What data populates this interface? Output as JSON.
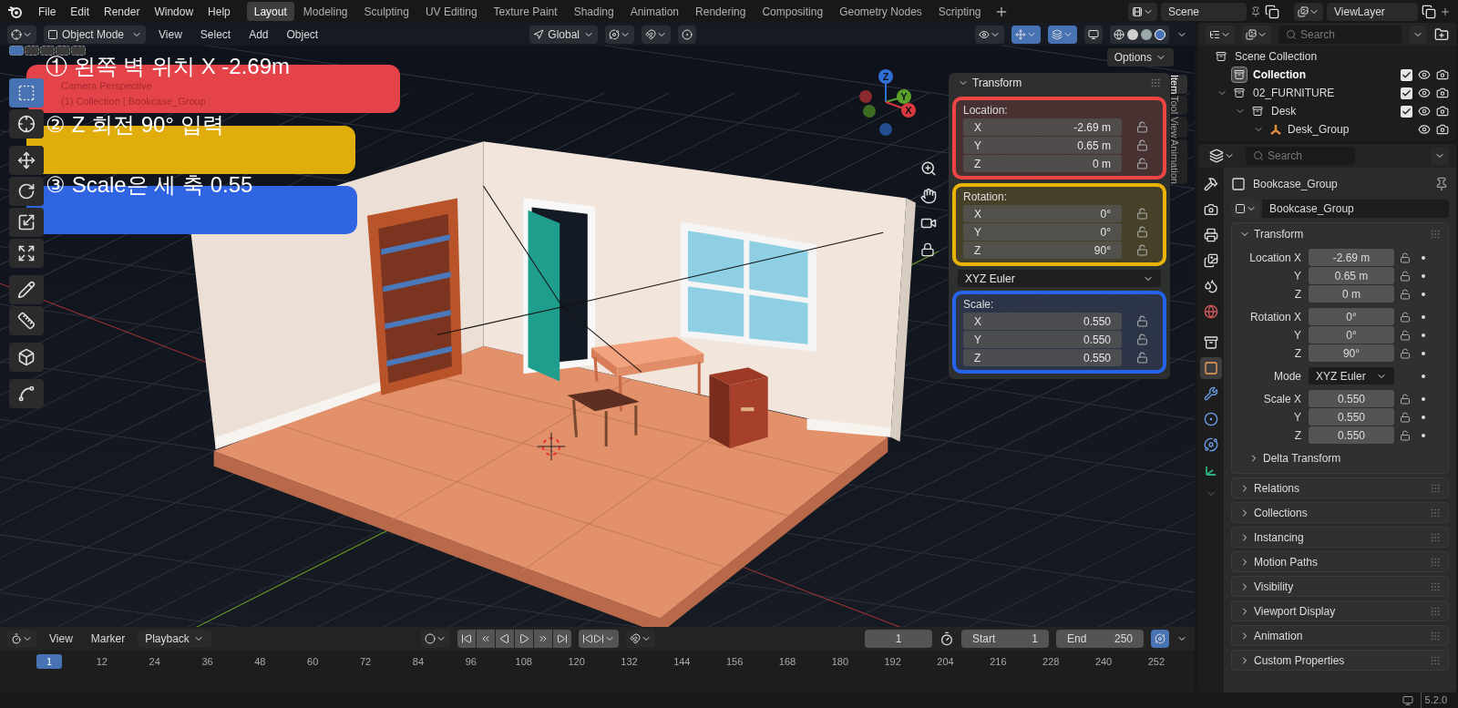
{
  "menu": [
    "File",
    "Edit",
    "Render",
    "Window",
    "Help"
  ],
  "workspaces": [
    {
      "label": "Layout",
      "selected": true
    },
    {
      "label": "Modeling",
      "selected": false
    },
    {
      "label": "Sculpting",
      "selected": false
    },
    {
      "label": "UV Editing",
      "selected": false
    },
    {
      "label": "Texture Paint",
      "selected": false
    },
    {
      "label": "Shading",
      "selected": false
    },
    {
      "label": "Animation",
      "selected": false
    },
    {
      "label": "Rendering",
      "selected": false
    },
    {
      "label": "Compositing",
      "selected": false
    },
    {
      "label": "Geometry Nodes",
      "selected": false
    },
    {
      "label": "Scripting",
      "selected": false
    }
  ],
  "scene": "Scene",
  "view_layer": "ViewLayer",
  "viewport_header": {
    "mode": "Object Mode",
    "menus": [
      "View",
      "Select",
      "Add",
      "Object"
    ],
    "orientation": "Global",
    "options": "Options"
  },
  "viewport": {
    "camera_label": "Camera Perspective",
    "collection_label": "(1) Collection | Bookcase_Group",
    "select_modes": [
      {
        "selected": true
      },
      {
        "selected": false
      },
      {
        "selected": false
      },
      {
        "selected": false
      },
      {
        "selected": false
      }
    ],
    "tools": [
      {
        "kind": "select",
        "selected": true
      },
      {
        "kind": "cursor",
        "selected": false
      },
      {
        "kind": "move",
        "selected": false
      },
      {
        "kind": "rotate",
        "selected": false
      },
      {
        "kind": "scale",
        "selected": false
      },
      {
        "kind": "transform",
        "selected": false
      },
      {
        "kind": "annotate",
        "selected": false
      },
      {
        "kind": "measure",
        "selected": false
      },
      {
        "kind": "add_cube",
        "selected": false
      },
      {
        "kind": "curve",
        "selected": false
      }
    ],
    "gizmo_axes": [
      "Z",
      "Y",
      "X"
    ],
    "annotations": [
      {
        "text": "① 왼쪽 벽 위치 X -2.69m",
        "color": "#e5434a"
      },
      {
        "text": "② Z 회전 90° 입력",
        "color": "#e0ad0a"
      },
      {
        "text": "③ Scale은 세 축 0.55",
        "color": "#2f64e2"
      }
    ]
  },
  "n_panel": {
    "tabs": [
      {
        "label": "Item",
        "selected": true
      },
      {
        "label": "Tool",
        "selected": false
      },
      {
        "label": "View",
        "selected": false
      },
      {
        "label": "Animation",
        "selected": false
      }
    ],
    "title": "Transform",
    "rotation_mode": "XYZ Euler",
    "groups": [
      {
        "label": "Location:",
        "color": "#ef4444",
        "fields": [
          {
            "axis": "X",
            "value": "-2.69 m"
          },
          {
            "axis": "Y",
            "value": "0.65 m"
          },
          {
            "axis": "Z",
            "value": "0 m"
          }
        ]
      },
      {
        "label": "Rotation:",
        "color": "#eab308",
        "fields": [
          {
            "axis": "X",
            "value": "0°"
          },
          {
            "axis": "Y",
            "value": "0°"
          },
          {
            "axis": "Z",
            "value": "90°"
          }
        ]
      },
      {
        "label": "Scale:",
        "color": "#2563eb",
        "fields": [
          {
            "axis": "X",
            "value": "0.550"
          },
          {
            "axis": "Y",
            "value": "0.550"
          },
          {
            "axis": "Z",
            "value": "0.550"
          }
        ]
      }
    ]
  },
  "outliner": {
    "search_placeholder": "Search",
    "tree": [
      {
        "label": "Scene Collection",
        "kind": "root",
        "selected": false,
        "children": [
          {
            "label": "Collection",
            "kind": "collection",
            "selected": true,
            "checked": true
          },
          {
            "label": "02_FURNITURE",
            "kind": "collection",
            "selected": false,
            "checked": true,
            "expanded": true,
            "children": [
              {
                "label": "Desk",
                "kind": "collection",
                "selected": false,
                "checked": true,
                "expanded": true,
                "children": [
                  {
                    "label": "Desk_Group",
                    "kind": "object",
                    "selected": false,
                    "expanded": true
                  }
                ]
              }
            ]
          }
        ]
      }
    ]
  },
  "properties": {
    "search_placeholder": "Search",
    "tabs": [
      {
        "kind": "tool",
        "selected": false
      },
      {
        "kind": "render",
        "selected": false
      },
      {
        "kind": "output",
        "selected": false
      },
      {
        "kind": "view_layer",
        "selected": false
      },
      {
        "kind": "scene",
        "selected": false
      },
      {
        "kind": "world",
        "selected": false
      },
      {
        "kind": "collection",
        "selected": false
      },
      {
        "kind": "object",
        "selected": true
      },
      {
        "kind": "modifiers",
        "selected": false
      },
      {
        "kind": "particles",
        "selected": false
      },
      {
        "kind": "physics",
        "selected": false
      },
      {
        "kind": "data",
        "selected": false
      }
    ],
    "object_name": "Bookcase_Group",
    "datablock": "Bookcase_Group",
    "transform": {
      "title": "Transform",
      "expanded": true,
      "groups": [
        {
          "kind": "number",
          "rows": [
            {
              "label": "Location X",
              "value": "-2.69 m"
            },
            {
              "label": "Y",
              "value": "0.65 m"
            },
            {
              "label": "Z",
              "value": "0 m"
            }
          ]
        },
        {
          "kind": "number",
          "rows": [
            {
              "label": "Rotation X",
              "value": "0°"
            },
            {
              "label": "Y",
              "value": "0°"
            },
            {
              "label": "Z",
              "value": "90°"
            }
          ]
        },
        {
          "kind": "dropdown",
          "rows": [
            {
              "label": "Mode",
              "value": "XYZ Euler"
            }
          ]
        },
        {
          "kind": "number",
          "rows": [
            {
              "label": "Scale X",
              "value": "0.550"
            },
            {
              "label": "Y",
              "value": "0.550"
            },
            {
              "label": "Z",
              "value": "0.550"
            }
          ]
        }
      ],
      "subpanel": {
        "label": "Delta Transform",
        "expanded": false
      }
    },
    "panels": [
      {
        "label": "Relations",
        "expanded": false
      },
      {
        "label": "Collections",
        "expanded": false
      },
      {
        "label": "Instancing",
        "expanded": false
      },
      {
        "label": "Motion Paths",
        "expanded": false
      },
      {
        "label": "Visibility",
        "expanded": false
      },
      {
        "label": "Viewport Display",
        "expanded": false
      },
      {
        "label": "Animation",
        "expanded": false
      },
      {
        "label": "Custom Properties",
        "expanded": false
      }
    ]
  },
  "timeline": {
    "menus": [
      "View",
      "Marker"
    ],
    "playback": "Playback",
    "current_frame": "1",
    "start_label": "Start",
    "start": "1",
    "end_label": "End",
    "end": "250",
    "ticks": [
      {
        "label": "1",
        "selected": true
      },
      {
        "label": "12",
        "selected": false
      },
      {
        "label": "24",
        "selected": false
      },
      {
        "label": "36",
        "selected": false
      },
      {
        "label": "48",
        "selected": false
      },
      {
        "label": "60",
        "selected": false
      },
      {
        "label": "72",
        "selected": false
      },
      {
        "label": "84",
        "selected": false
      },
      {
        "label": "96",
        "selected": false
      },
      {
        "label": "108",
        "selected": false
      },
      {
        "label": "120",
        "selected": false
      },
      {
        "label": "132",
        "selected": false
      },
      {
        "label": "144",
        "selected": false
      },
      {
        "label": "156",
        "selected": false
      },
      {
        "label": "168",
        "selected": false
      },
      {
        "label": "180",
        "selected": false
      },
      {
        "label": "192",
        "selected": false
      },
      {
        "label": "204",
        "selected": false
      },
      {
        "label": "216",
        "selected": false
      },
      {
        "label": "228",
        "selected": false
      },
      {
        "label": "240",
        "selected": false
      },
      {
        "label": "252",
        "selected": false
      }
    ]
  },
  "status_bar": {
    "version": "5.2.0"
  }
}
